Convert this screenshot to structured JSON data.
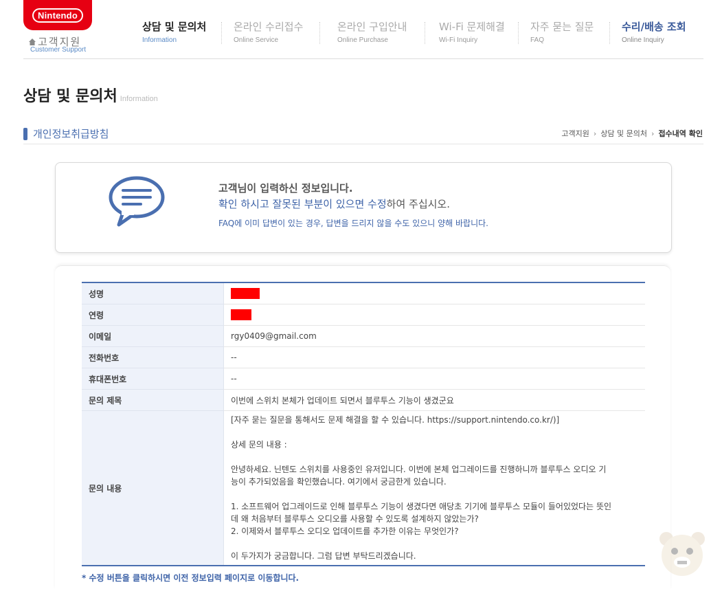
{
  "header": {
    "logo_text": "Nintendo",
    "support_title": "고객지원",
    "support_subtitle": "Customer Support"
  },
  "nav": [
    {
      "ko": "상담 및 문의처",
      "en": "Information"
    },
    {
      "ko": "온라인 수리접수",
      "en": "Online Service"
    },
    {
      "ko": "온라인 구입안내",
      "en": "Online Purchase"
    },
    {
      "ko": "Wi-Fi 문제해결",
      "en": "Wi-Fi Inquiry"
    },
    {
      "ko": "자주 묻는 질문",
      "en": "FAQ"
    },
    {
      "ko": "수리/배송 조회",
      "en": "Online Inquiry"
    }
  ],
  "page": {
    "title": "상담 및 문의처",
    "title_en": "Information",
    "section_title": "개인정보취급방침"
  },
  "breadcrumb": [
    "고객지원",
    "상담 및 문의처",
    "접수내역 확인"
  ],
  "notice": {
    "line1": "고객님이 입력하신 정보입니다.",
    "line2_blue": "확인 하시고 잘못된 부분이 있으면 수정",
    "line2_rest": "하여 주십시오.",
    "line3": "FAQ에 이미 답변이 있는 경우, 답변을 드리지 않을 수도 있으니 양해 바랍니다."
  },
  "form": {
    "name_label": "성명",
    "age_label": "연령",
    "email_label": "이메일",
    "email_value": "rgy0409@gmail.com",
    "phone_label": "전화번호",
    "phone_value": "--",
    "mobile_label": "휴대폰번호",
    "mobile_value": "--",
    "subject_label": "문의 제목",
    "subject_value": "이번에 스위치 본체가 업데이트 되면서 블루투스 기능이 생겼군요",
    "content_label": "문의 내용",
    "content_lines": {
      "l1": "[자주 묻는 질문을 통해서도 문제 해결을 할 수 있습니다. https://support.nintendo.co.kr/)]",
      "l2": "상세 문의 내용 :",
      "l3": "안녕하세요. 닌텐도 스위치를 사용중인 유저입니다. 이번에 본체 업그레이드를 진행하니까 블루투스 오디오 기",
      "l4": "능이 추가되었음을 확인했습니다. 여기에서 궁금한게 있습니다.",
      "l5": "1. 소프트웨어 업그레이드로 인해 블루투스 기능이 생겼다면 애당초 기기에 블루투스 모듈이 들어있었다는 뜻인",
      "l6": "데 왜 처음부터 블루투스 오디오를 사용할 수 있도록 설계하지 않았는가?",
      "l7": "2. 이제와서 블루투스 오디오 업데이트를 추가한 이유는 무엇인가?",
      "l8": "이 두가지가 궁금합니다. 그럼 답변 부탁드리겠습니다."
    }
  },
  "footnote": "* 수정 버튼을 클릭하시면 이전 정보입력 페이지로 이동합니다.",
  "colors": {
    "brand_red": "#e60012",
    "accent_blue": "#4a6fb0",
    "redaction": "#ff0000"
  }
}
